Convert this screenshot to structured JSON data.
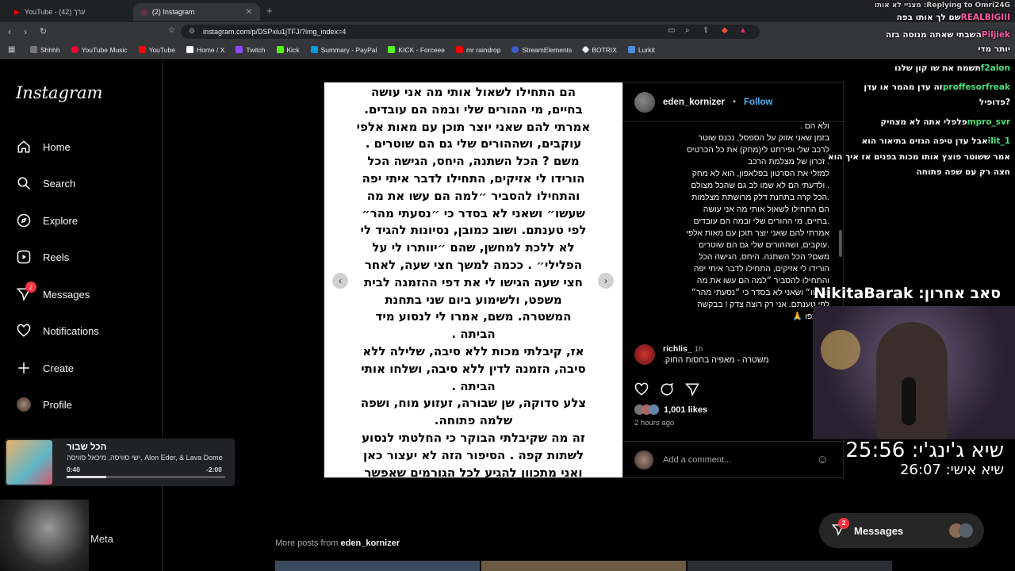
{
  "browser": {
    "tabs": [
      {
        "label": "YouTube - ערך (42)",
        "active": false
      },
      {
        "label": "(2) Instagram",
        "active": true
      }
    ],
    "url": "instagram.com/p/DSPxiu1jTFJ/?img_index=4",
    "bookmarks": [
      "Shhhh",
      "YouTube Music",
      "YouTube",
      "Home / X",
      "Twitch",
      "Kick",
      "Summary - PayPal",
      "KICK - Forceee",
      "mr raindrop",
      "StreamElements",
      "BOTRIX",
      "Lurkit"
    ]
  },
  "instagram": {
    "logo": "Instagram",
    "nav": {
      "home": "Home",
      "search": "Search",
      "explore": "Explore",
      "reels": "Reels",
      "messages": "Messages",
      "messages_badge": "2",
      "notifications": "Notifications",
      "create": "Create",
      "profile": "Profile"
    },
    "post": {
      "image_text": "הם התחילו לשאול אותי מה אני עושה\nבחיים, מי ההורים שלי ובמה הם עובדים.\nאמרתי להם שאני יוצר תוכן עם מאות אלפי\nעוקבים, ושההורים שלי גם הם שוטרים .\nמשם ? הכל השתנה, היחס, הגישה הכל\nהורידו לי אזיקים, התחילו לדבר איתי יפה\nוהתחילו להסביר ״למה הם עשו את מה\nשעשו״ ושאני לא בסדר כי ״נסעתי מהר״\nלפי טענתם. ושוב כמובן, נסיונות להגיד לי\nלא ללכת למחשן, שהם ״יוותרו לי על\nהפלילי״ . ככמה למשך חצי שעה, לאחר\nחצי שעה הגישו לי את דפי ההזמנה לבית\nמשפט, ולשימוע ביום שני בתחנת\nהמשטרה. משם, אמרו לי לנסוע מיד\nהביתה .\nאז, קיבלתי מכות ללא סיבה, שלילה ללא\nסיבה, הזמנה לדין ללא סיבה, ושלחו אותי\nהביתה .\nצלע סדוקה, שן שבורה, זעזוע מוח, ושפה\nשלמה פתוחה.\nזה מה שקיבלתי הבוקר כי החלטתי לנסוע\nלשתות קפה . הסיפור הזה לא יעצור כאן\nואני מתכוון להגיע לכל הגורמים שאפשר",
      "author": "eden_kornizer",
      "follow": "Follow",
      "caption": "ולא הם .\nבזמן שאני אזוק על הספסל, נכנס שוטר\nלרכב שלי ופירתט לי(מחק) את כל הכרטיס\n. זכרון של מצלמת הרכב\nלמזלי את הסרטון בפלאפון, הוא לא מחק\n. ולדעתי הם לא שמו לב גם שהכל מצולם\n.הכל קרה בתחנת דלק מרושתת מצלמות\nהם התחילו לשאול אותי מה אני עושה\n.בחיים, מי ההורים שלי ובמה הם עובדים\nאמרתי להם שאני יוצר תוכן עם מאות אלפי\n.עוקבים, ושההורים שלי גם הם שוטרים\nמשם? הכל השתנה. היחס, הגישה הכל\nהורידו לי אזיקים, התחילו לדבר איתי יפה\nוהתחילו להסביר ״למה הם עשו את מה\nשעשו״ ושאני לא בסדר כי ״נסעתי מהר״\nלפי טענתם. אני רק רוצה צדק ! בבקשה\nתשתפו 🙏",
      "comment": {
        "user": "richlis_",
        "time": "1h",
        "text": "משטרה - מאפיה בחסות החוק."
      },
      "likes": "1,001 likes",
      "posted": "2 hours ago",
      "add_comment_placeholder": "Add a comment...",
      "more_posts_prefix": "More posts from",
      "more_posts_user": "eden_kornizer"
    },
    "messages_pill": "Messages",
    "messages_pill_badge": "2"
  },
  "music_player": {
    "title": "הכל שבור",
    "artists": "ישי סוויסה, מיכאל סוויסה, Alon Eder, & Lava Dome",
    "elapsed": "0:40",
    "remaining": "-2:00",
    "progress": 0.25
  },
  "meta_overlay": "Meta",
  "stream_chat": {
    "replying": "Replying to Omri24G: מצגיי לא אותו",
    "messages": [
      {
        "user": "REALBIGIII",
        "text": "שם לך אותו בפה"
      },
      {
        "user": "Piljiek",
        "text": "השבתי שאתה מנוסה בזה"
      },
      {
        "user": "",
        "text": "יותר מדי"
      },
      {
        "user": "f2alon",
        "text": "תשמח את שו קון שלנו"
      },
      {
        "user": "proffesorfreak",
        "text": "זה עדן מהמר או עדן"
      },
      {
        "user": "",
        "text": "?פדופיל"
      },
      {
        "user": "mpro_svr",
        "text": "פלפלי אתה לא מצחיק"
      },
      {
        "user": "ilit_1",
        "text": "אבל עדן טיפה הגזים בתיאור הוא"
      },
      {
        "user": "",
        "text": "אמר ששוטר פוצץ אותו מכות בפנים אז איך הוא"
      },
      {
        "user": "",
        "text": "חצה רק עם שפה פתוחה"
      }
    ]
  },
  "stream_overlay": {
    "last_sub": "סאב אחרון: NikitaBarak",
    "timer_main": "שיא ג'ינג'י: 25:56",
    "timer_personal": "שיא אישי: 26:07"
  }
}
